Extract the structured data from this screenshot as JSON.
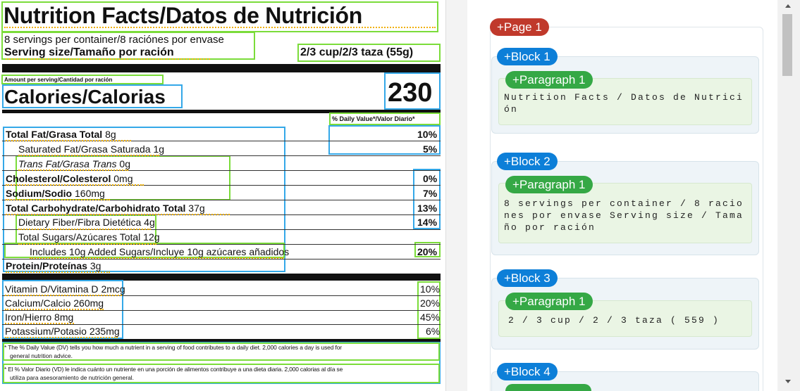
{
  "label": {
    "title": "Nutrition Facts/Datos de Nutrición",
    "servings": "8 servings per container/8 raciónes por envase",
    "serving_size_label": "Serving size/Tamaño por ración",
    "serving_size_value": "2/3 cup/2/3 taza (55g)",
    "amount_per_serving": "Amount per serving/Cantidad por ración",
    "calories_label": "Calories/Calorias",
    "calories_value": "230",
    "dv_header": "% Daily Value*/Valor Diario*",
    "nutrients": [
      {
        "name": "Total Fat/Grasa Total",
        "amount": "8g",
        "dv": "10%"
      },
      {
        "name": "Saturated Fat/Grasa Saturada",
        "amount": "1g",
        "dv": "5%"
      },
      {
        "name": "Trans Fat/Grasa Trans",
        "amount": "0g",
        "dv": ""
      },
      {
        "name": "Cholesterol/Colesterol",
        "amount": "0mg",
        "dv": "0%"
      },
      {
        "name": "Sodium/Sodio",
        "amount": "160mg",
        "dv": "7%"
      },
      {
        "name": "Total Carbohydrate/Carbohidrato Total",
        "amount": "37g",
        "dv": "13%"
      },
      {
        "name": "Dietary Fiber/Fibra Dietética",
        "amount": "4g",
        "dv": "14%"
      },
      {
        "name": "Total Sugars/Azúcares Total",
        "amount": "12g",
        "dv": ""
      },
      {
        "name": "Includes 10g Added Sugars/Incluye 10g azúcares añadidos",
        "amount": "",
        "dv": "20%"
      },
      {
        "name": "Protein/Proteínas",
        "amount": "3g",
        "dv": ""
      }
    ],
    "vitamins": [
      {
        "name": "Vitamin D/Vitamina D",
        "amount": "2mcg",
        "dv": "10%"
      },
      {
        "name": "Calcium/Calcio",
        "amount": "260mg",
        "dv": "20%"
      },
      {
        "name": "Iron/Hierro",
        "amount": "8mg",
        "dv": "45%"
      },
      {
        "name": "Potassium/Potasio",
        "amount": "235mg",
        "dv": "6%"
      }
    ],
    "footnote_en_1": "* The % Daily Value (DV) tells you how much a nutrient in a serving of food contributes to a daily diet. 2,000 calories a day is used for",
    "footnote_en_2": "general nutrition advice.",
    "footnote_es_1": "* El % Valor Diario (VD) le indica cuánto un nutriente en una porción de alimentos contribuye a una dieta diaria. 2,000 calorias al día se",
    "footnote_es_2": "utiliza para asesoramiento de nutrición general."
  },
  "panel": {
    "page_label": "+Page 1",
    "blocks": [
      {
        "label": "+Block 1",
        "paragraph_label": "+Paragraph 1",
        "text": " Nutrition Facts / Datos de Nutrición"
      },
      {
        "label": "+Block 2",
        "paragraph_label": "+Paragraph 1",
        "text": " 8 servings per container / 8 raciones por envase Serving size / Tamaño por ración"
      },
      {
        "label": "+Block 3",
        "paragraph_label": "+Paragraph 1",
        "text": "2 / 3 cup / 2 / 3 taza ( 559 )"
      },
      {
        "label": "+Block 4",
        "paragraph_label": "",
        "text": ""
      }
    ]
  },
  "colors": {
    "paragraph_box": "#7bdc3a",
    "block_box": "#34a8e8",
    "word_underline": "#f0b000",
    "page_pill": "#c0392b",
    "block_pill": "#0d7fd8",
    "paragraph_pill": "#35a845"
  }
}
